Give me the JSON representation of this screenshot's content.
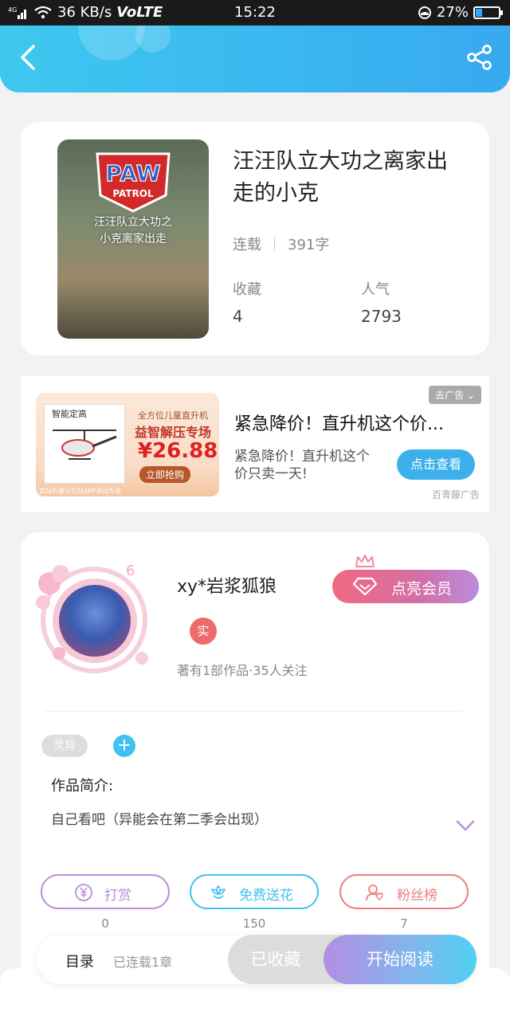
{
  "status_bar": {
    "network": "4G",
    "speed": "36 KB/s",
    "volte": "VoLTE",
    "time": "15:22",
    "battery_percent": "27%",
    "battery_level": 0.27
  },
  "book": {
    "cover_logo_top": "PAW",
    "cover_logo_bottom": "PATROL",
    "cover_title": "汪汪队立大功之\n小克离家出走",
    "title": "汪汪队立大功之离家出走的小克",
    "status": "连载",
    "word_count": "391字",
    "favorites_label": "收藏",
    "favorites_value": "4",
    "popularity_label": "人气",
    "popularity_value": "2793"
  },
  "ad": {
    "tag": "去广告",
    "image_text": {
      "box_title": "智能定高",
      "line1": "全方位儿童直升机",
      "line2": "益智解压专场",
      "price": "¥26.88",
      "buy": "立即抢购",
      "disclaimer": "实际价格以实际APP活动为准"
    },
    "title": "紧急降价！直升机这个价...",
    "description": "紧急降价！直升机这个价只卖一天!",
    "button": "点击查看",
    "source": "百青藤广告"
  },
  "author": {
    "level": "6",
    "name": "xy*岩浆狐狼",
    "real_badge": "实",
    "stats": "著有1部作品·35人关注",
    "vip_button": "点亮会员"
  },
  "work": {
    "tag": "灵异",
    "add_tag": "+",
    "intro_title": "作品简介:",
    "intro_text": "自己看吧（异能会在第二季会出现）"
  },
  "actions": [
    {
      "label": "打赏",
      "count": "0",
      "color": "#b98ddc",
      "icon": "yen-icon"
    },
    {
      "label": "免费送花",
      "count": "150",
      "color": "#40c1f0",
      "icon": "flower-icon"
    },
    {
      "label": "粉丝榜",
      "count": "7",
      "color": "#ef7d7d",
      "icon": "fans-icon"
    }
  ],
  "bottom": {
    "toc": "目录",
    "toc_sub": "已连载1章",
    "fav_button": "已收藏",
    "read_button": "开始阅读"
  }
}
